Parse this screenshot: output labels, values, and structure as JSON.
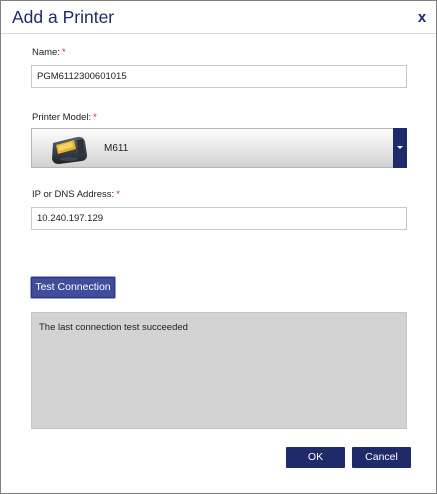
{
  "dialog": {
    "title": "Add a Printer",
    "close_label": "x"
  },
  "name": {
    "label": "Name:",
    "required_mark": "*",
    "value": "PGM6112300601015"
  },
  "printer_model": {
    "label": "Printer Model:",
    "required_mark": "*",
    "selected": "M611",
    "image_icon": "printer-icon"
  },
  "address": {
    "label": "IP or DNS Address:",
    "required_mark": "*",
    "value": "10.240.197.129"
  },
  "test": {
    "button_label": "Test Connection",
    "result_text": "The last connection test succeeded"
  },
  "footer": {
    "ok_label": "OK",
    "cancel_label": "Cancel"
  },
  "colors": {
    "accent": "#1f2a6b",
    "required": "#d12b2b",
    "result_bg": "#d3d3d3"
  }
}
